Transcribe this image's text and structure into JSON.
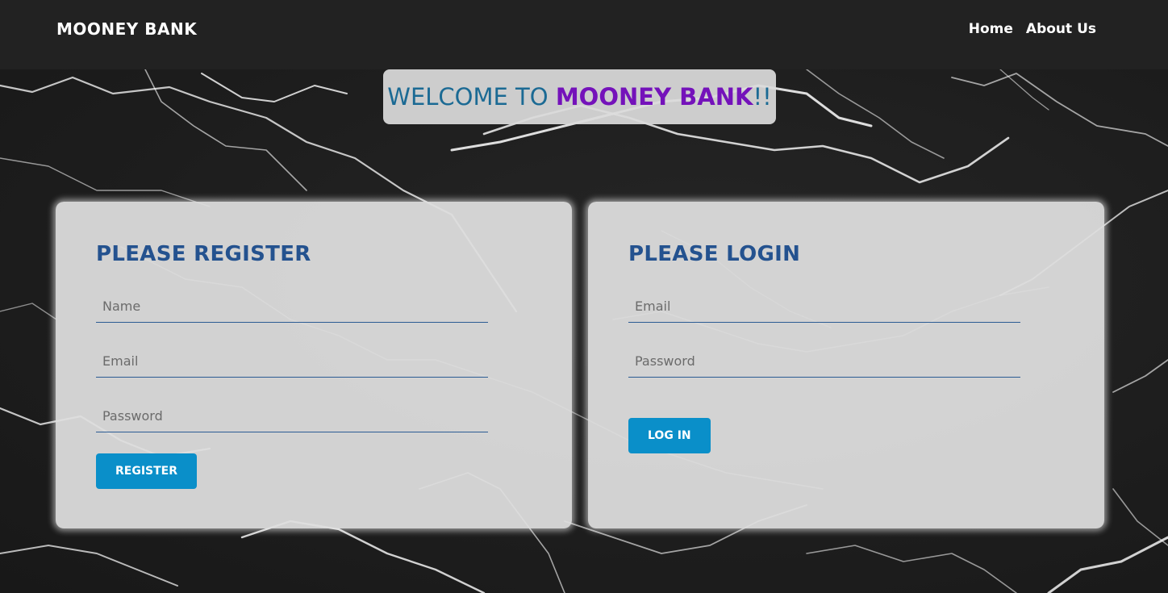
{
  "navbar": {
    "brand": "MOONEY BANK",
    "links": [
      "Home",
      "About Us"
    ]
  },
  "welcome": {
    "prefix": "WELCOME TO ",
    "highlight": "MOONEY BANK",
    "suffix": "!!"
  },
  "register": {
    "title": "PLEASE REGISTER",
    "name_placeholder": "Name",
    "email_placeholder": "Email",
    "password_placeholder": "Password",
    "button_label": "REGISTER"
  },
  "login": {
    "title": "PLEASE LOGIN",
    "email_placeholder": "Email",
    "password_placeholder": "Password",
    "button_label": "LOG IN"
  },
  "colors": {
    "navbar_bg": "#222222",
    "title_blue": "#24528f",
    "welcome_text": "#1b6a94",
    "welcome_accent": "#7412ba",
    "button_bg": "#0a8fc9"
  }
}
